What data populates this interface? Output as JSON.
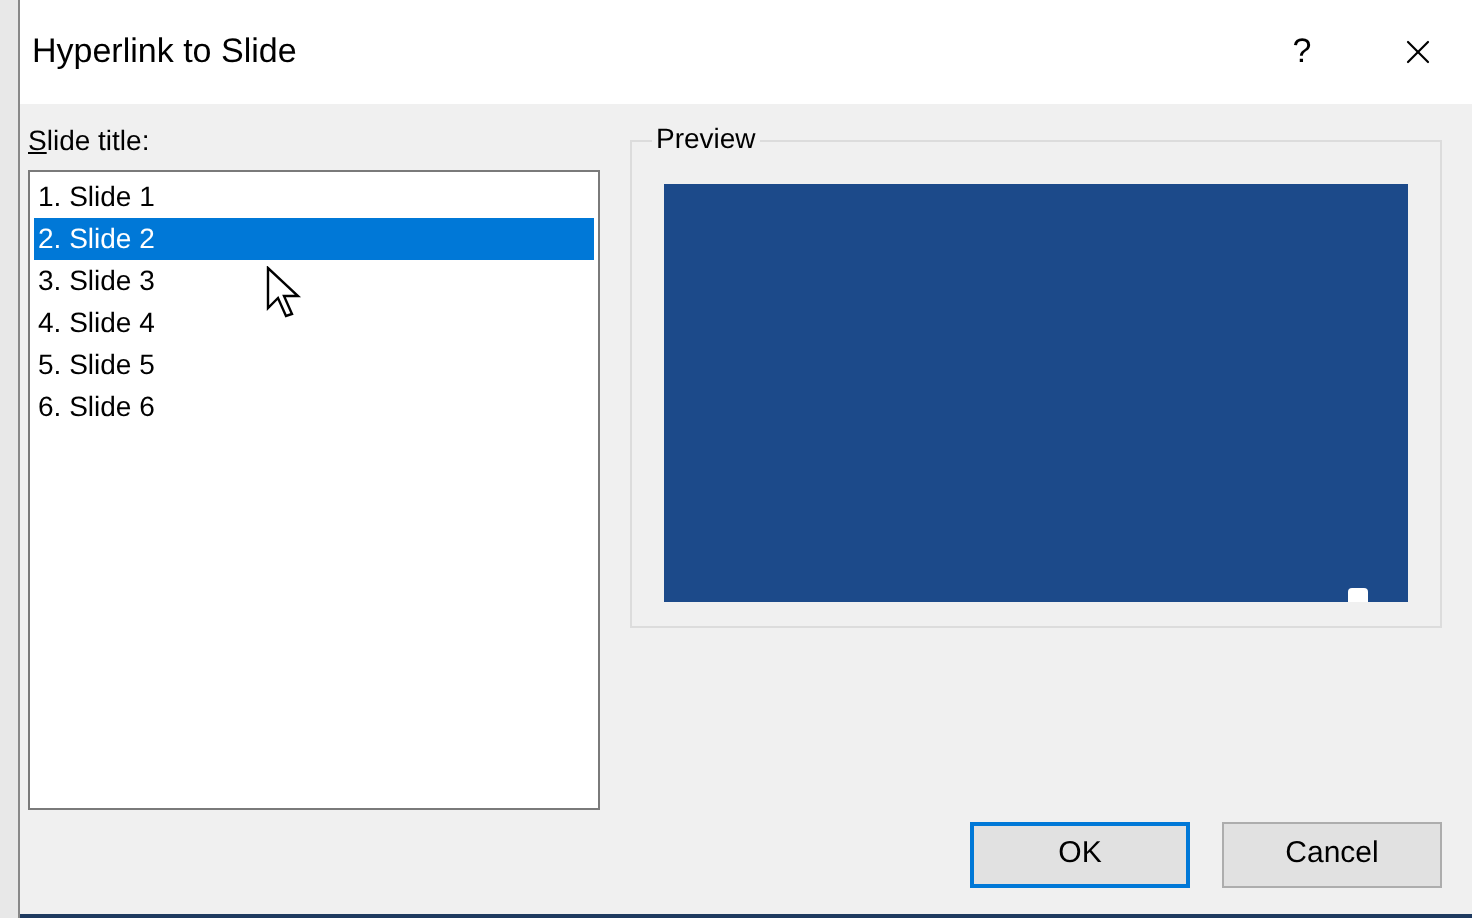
{
  "window": {
    "title": "Hyperlink to Slide",
    "help": "?"
  },
  "slide_list": {
    "label": "Slide title:",
    "items": [
      {
        "label": "1. Slide 1",
        "selected": false
      },
      {
        "label": "2. Slide 2",
        "selected": true
      },
      {
        "label": "3. Slide 3",
        "selected": false
      },
      {
        "label": "4. Slide 4",
        "selected": false
      },
      {
        "label": "5. Slide 5",
        "selected": false
      },
      {
        "label": "6. Slide 6",
        "selected": false
      }
    ]
  },
  "preview": {
    "label": "Preview"
  },
  "buttons": [
    {
      "label": "OK",
      "default": true
    },
    {
      "label": "Cancel",
      "default": false
    }
  ]
}
